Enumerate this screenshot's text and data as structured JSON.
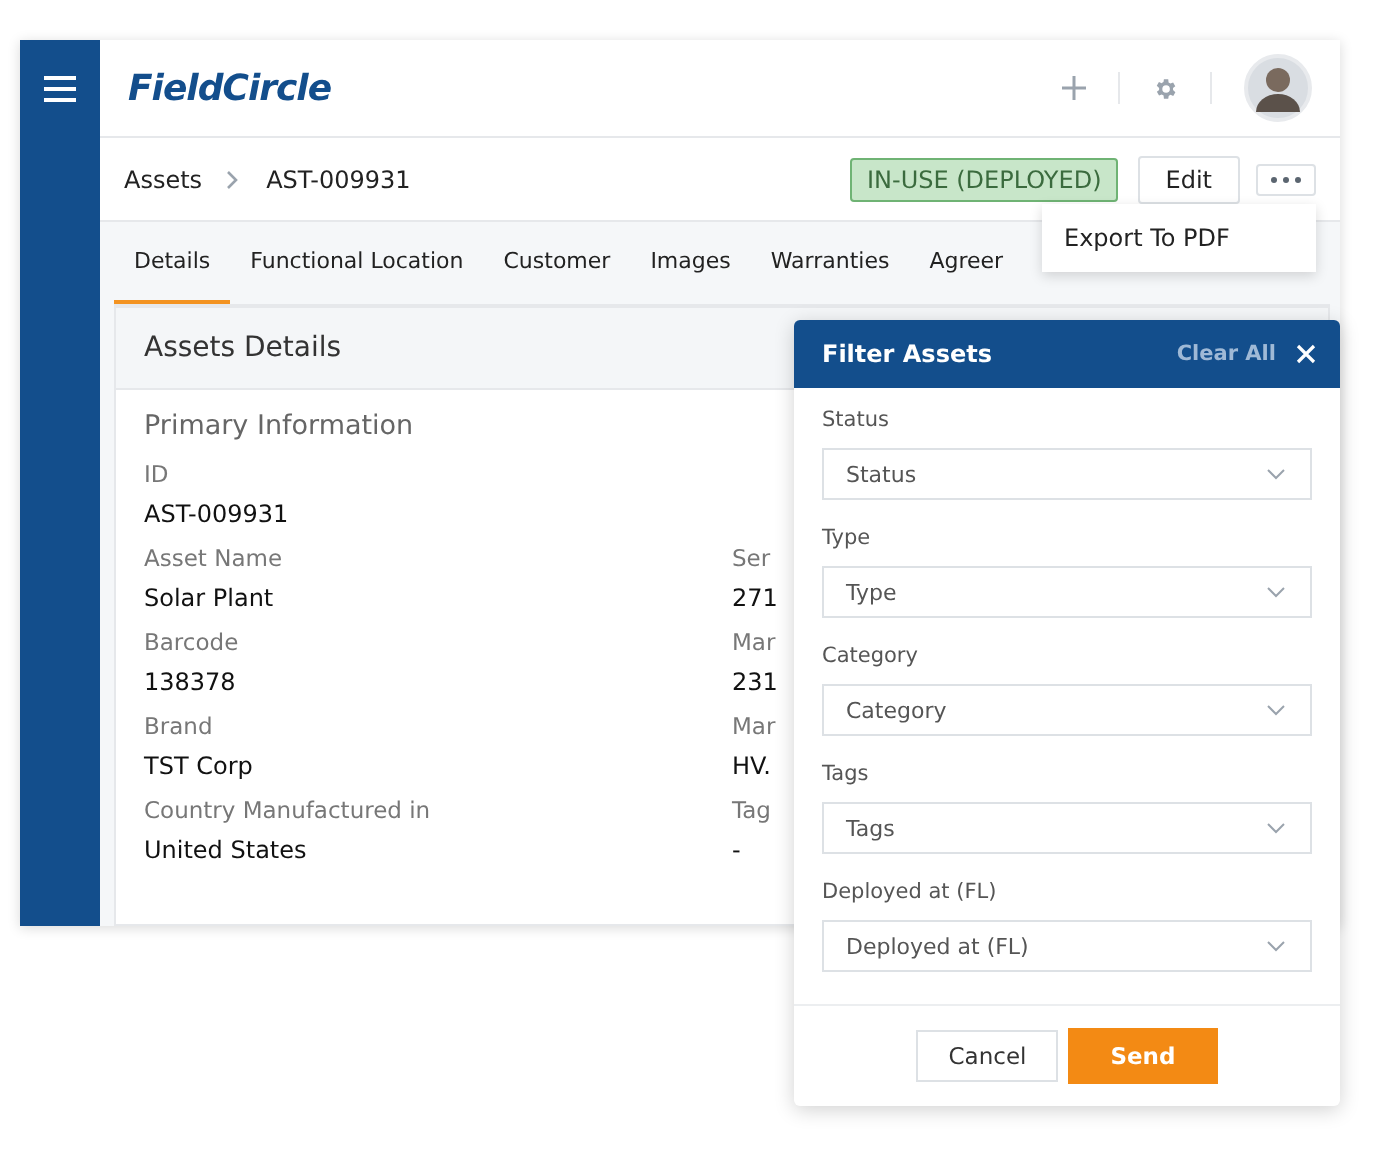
{
  "header": {
    "logo": "FieldCircle"
  },
  "breadcrumb": [
    "Assets",
    "AST-009931"
  ],
  "status": "IN-USE (DEPLOYED)",
  "edit": "Edit",
  "more_menu": [
    "Export To PDF"
  ],
  "tabs": [
    {
      "label": "Details",
      "selected": true
    },
    {
      "label": "Functional Location",
      "selected": false
    },
    {
      "label": "Customer",
      "selected": false
    },
    {
      "label": "Images",
      "selected": false
    },
    {
      "label": "Warranties",
      "selected": false
    },
    {
      "label": "Agreer",
      "selected": false
    }
  ],
  "panel_title": "Assets Details",
  "section_title": "Primary Information",
  "rows": [
    [
      {
        "label": "ID",
        "value": "AST-009931"
      }
    ],
    [
      {
        "label": "Asset Name",
        "value": "Solar Plant"
      },
      {
        "label": "Ser",
        "value": "271"
      }
    ],
    [
      {
        "label": "Barcode",
        "value": "138378"
      },
      {
        "label": "Mar",
        "value": "231"
      }
    ],
    [
      {
        "label": "Brand",
        "value": "TST Corp"
      },
      {
        "label": "Mar",
        "value": "HV."
      }
    ],
    [
      {
        "label": "Country Manufactured in",
        "value": "United States"
      },
      {
        "label": "Tag",
        "value": "-"
      }
    ]
  ],
  "filter": {
    "title": "Filter Assets",
    "clear": "Clear All",
    "fields": [
      {
        "label": "Status",
        "placeholder": "Status"
      },
      {
        "label": "Type",
        "placeholder": "Type"
      },
      {
        "label": "Category",
        "placeholder": "Category"
      },
      {
        "label": "Tags",
        "placeholder": "Tags"
      },
      {
        "label": "Deployed at (FL)",
        "placeholder": "Deployed at (FL)"
      }
    ],
    "cancel": "Cancel",
    "send": "Send"
  }
}
